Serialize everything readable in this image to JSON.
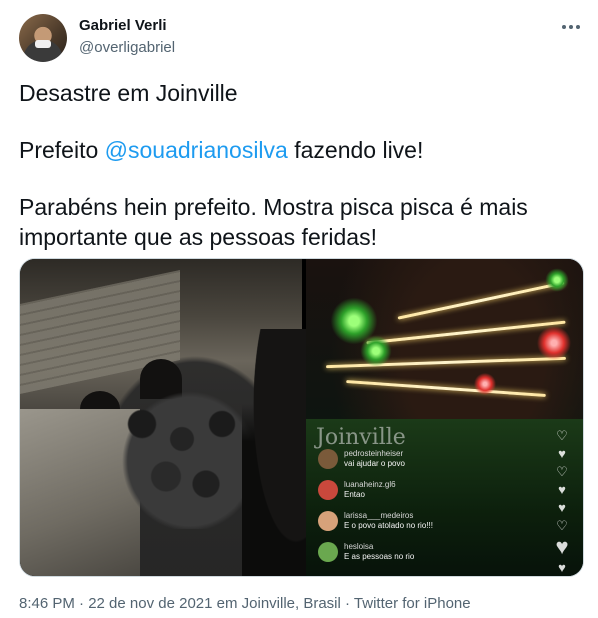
{
  "author": {
    "name": "Gabriel Verli",
    "handle": "@overligabriel",
    "avatar_icon": "profile-photo"
  },
  "menu": {
    "icon": "more-horizontal-icon"
  },
  "tweet": {
    "line1": "Desastre em Joinville",
    "line2_prefix": "Prefeito ",
    "line2_mention": "@souadrianosilva",
    "line2_suffix": " fazendo live!",
    "line3": "Parabéns hein prefeito. Mostra pisca pisca é mais importante que as pessoas feridas!"
  },
  "media": {
    "right_image": {
      "watermark": "Joinville",
      "comments": [
        {
          "user": "pedrosteinheiser",
          "text": "vai ajudar o povo",
          "avatar_color": "#7a5a3a"
        },
        {
          "user": "luanaheinz.gl6",
          "text": "Entao",
          "avatar_color": "#c9483c"
        },
        {
          "user": "larissa___medeiros",
          "text": "E o povo atolado no rio!!!",
          "avatar_color": "#d7a27a"
        },
        {
          "user": "hesloisa",
          "text": "E as pessoas no rio",
          "avatar_color": "#6aa84f"
        }
      ]
    }
  },
  "footer": {
    "meta": "8:46 PM · 22 de nov de 2021 em Joinville, Brasil · Twitter for iPhone"
  },
  "colors": {
    "link": "#1d9bf0",
    "secondary_text": "#536471",
    "primary_text": "#0f1419"
  }
}
